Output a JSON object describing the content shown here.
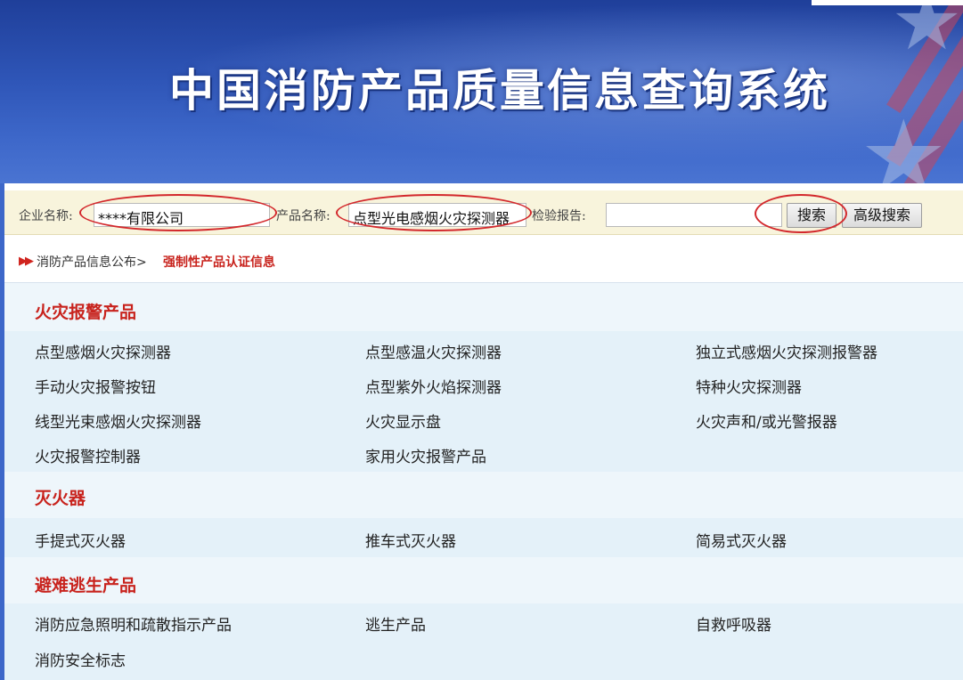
{
  "banner": {
    "title": "中国消防产品质量信息查询系统"
  },
  "search": {
    "company_label": "企业名称:",
    "company_value": "****有限公司",
    "product_label": "产品名称:",
    "product_value": "点型光电感烟火灾探测器",
    "report_label": "检验报告:",
    "report_value": "",
    "search_button": "搜索",
    "advanced_button": "高级搜索"
  },
  "breadcrumb": {
    "arrows": "▶▶",
    "home": "消防产品信息公布>",
    "current": "强制性产品认证信息"
  },
  "categories": [
    {
      "title": "火灾报警产品",
      "items": [
        "点型感烟火灾探测器",
        "点型感温火灾探测器",
        "独立式感烟火灾探测报警器",
        "手动火灾报警按钮",
        "点型紫外火焰探测器",
        "特种火灾探测器",
        "线型光束感烟火灾探测器",
        "火灾显示盘",
        "火灾声和/或光警报器",
        "火灾报警控制器",
        "家用火灾报警产品"
      ]
    },
    {
      "title": "灭火器",
      "items": [
        "手提式灭火器",
        "推车式灭火器",
        "简易式灭火器"
      ]
    },
    {
      "title": "避难逃生产品",
      "items": [
        "消防应急照明和疏散指示产品",
        "逃生产品",
        "自救呼吸器",
        "消防安全标志"
      ]
    }
  ],
  "colors": {
    "banner_blue": "#2f56b8",
    "category_red": "#c8231d",
    "annotation_red": "#d3282c",
    "search_bar_bg": "#f8f4dc",
    "row_bg": "#e4f1f9"
  }
}
